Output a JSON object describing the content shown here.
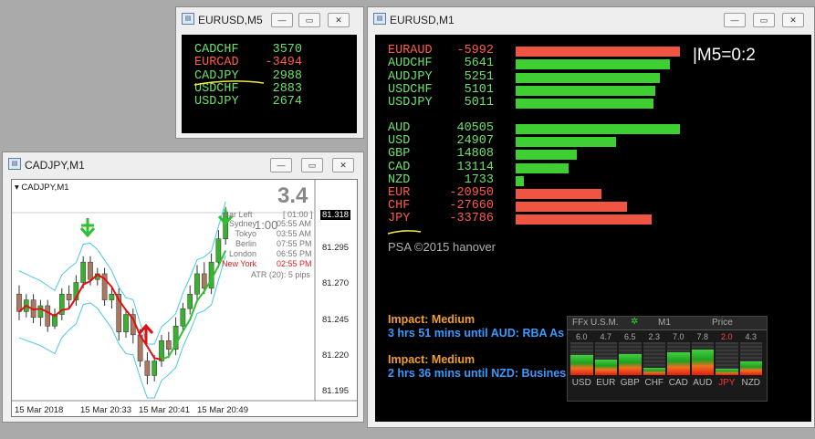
{
  "win_m5": {
    "title": "EURUSD,M5",
    "rows": [
      {
        "pair": "CADCHF",
        "value": "3570",
        "color": "green"
      },
      {
        "pair": "EURCAD",
        "value": "-3494",
        "color": "red"
      },
      {
        "pair": "CADJPY",
        "value": "2988",
        "color": "green"
      },
      {
        "pair": "USDCHF",
        "value": "2883",
        "color": "green"
      },
      {
        "pair": "USDJPY",
        "value": "2674",
        "color": "green"
      }
    ]
  },
  "win_m1": {
    "title": "EURUSD,M1",
    "pairs": [
      {
        "pair": "EURAUD",
        "value": "-5992",
        "color": "red",
        "bar": 1.0
      },
      {
        "pair": "AUDCHF",
        "value": "5641",
        "color": "green",
        "bar": 0.94
      },
      {
        "pair": "AUDJPY",
        "value": "5251",
        "color": "green",
        "bar": 0.88
      },
      {
        "pair": "USDCHF",
        "value": "5101",
        "color": "green",
        "bar": 0.85
      },
      {
        "pair": "USDJPY",
        "value": "5011",
        "color": "green",
        "bar": 0.84
      }
    ],
    "currencies": [
      {
        "ccy": "AUD",
        "value": "40505",
        "color": "green",
        "bar": 1.0
      },
      {
        "ccy": "USD",
        "value": "24907",
        "color": "green",
        "bar": 0.61
      },
      {
        "ccy": "GBP",
        "value": "14808",
        "color": "green",
        "bar": 0.37
      },
      {
        "ccy": "CAD",
        "value": "13114",
        "color": "green",
        "bar": 0.32
      },
      {
        "ccy": "NZD",
        "value": "1733",
        "color": "green",
        "bar": 0.05
      },
      {
        "ccy": "EUR",
        "value": "-20950",
        "color": "red",
        "bar": 0.52
      },
      {
        "ccy": "CHF",
        "value": "-27660",
        "color": "red",
        "bar": 0.68
      },
      {
        "ccy": "JPY",
        "value": "-33786",
        "color": "red",
        "bar": 0.83
      }
    ],
    "ratio": "|M5=0:2",
    "copyright": "PSA ©2015 hanover",
    "news": [
      {
        "impact": "Impact: Medium",
        "text": "3 hrs 51 mins until AUD: RBA As"
      },
      {
        "impact": "Impact: Medium",
        "text": "2 hrs 36 mins until NZD: Busines"
      }
    ],
    "hud": {
      "title": "FFx U.S.M.",
      "timeframe": "M1",
      "mode": "Price",
      "currencies": [
        {
          "ccy": "USD",
          "value": "6.0",
          "level": 0.6
        },
        {
          "ccy": "EUR",
          "value": "4.7",
          "level": 0.47
        },
        {
          "ccy": "GBP",
          "value": "6.5",
          "level": 0.65
        },
        {
          "ccy": "CHF",
          "value": "2.3",
          "level": 0.23
        },
        {
          "ccy": "CAD",
          "value": "7.0",
          "level": 0.7
        },
        {
          "ccy": "AUD",
          "value": "7.8",
          "level": 0.78
        },
        {
          "ccy": "JPY",
          "value": "2.0",
          "level": 0.2,
          "highlight": true
        },
        {
          "ccy": "NZD",
          "value": "4.3",
          "level": 0.43
        }
      ]
    }
  },
  "win_cadjpy": {
    "title": "CADJPY,M1",
    "symbol": "CADJPY,M1",
    "big_value": "3.4",
    "bar_left_label": "Bar Left",
    "bar_left_value": "[ 01:00 ]",
    "countdown": "1:00",
    "sessions": [
      {
        "name": "Sydney",
        "time": "05:55 AM",
        "active": false
      },
      {
        "name": "Tokyo",
        "time": "03:55 AM",
        "active": false
      },
      {
        "name": "Berlin",
        "time": "07:55 PM",
        "active": false
      },
      {
        "name": "London",
        "time": "06:55 PM",
        "active": false
      },
      {
        "name": "New York",
        "time": "02:55 PM",
        "active": true
      }
    ],
    "atr": "ATR (20): 5 pips",
    "current_price": "81.318",
    "y_ticks": [
      "81.295",
      "81.270",
      "81.245",
      "81.220",
      "81.195"
    ],
    "x_ticks": [
      "15 Mar 2018",
      "15 Mar 20:33",
      "15 Mar 20:41",
      "15 Mar 20:49"
    ]
  }
}
